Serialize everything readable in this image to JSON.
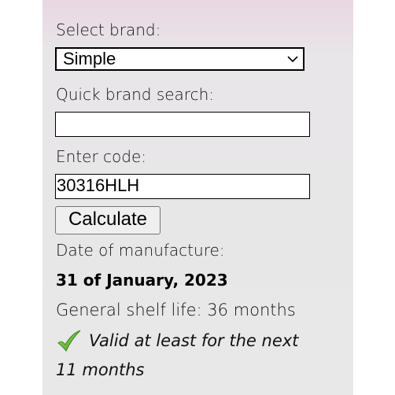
{
  "brand_selector": {
    "label": "Select brand:",
    "selected": "Simple"
  },
  "quick_search": {
    "label": "Quick brand search:",
    "value": ""
  },
  "code": {
    "label": "Enter code:",
    "value": "30316HLH"
  },
  "calculate_button": "Calculate",
  "result": {
    "date_label": "Date of manufacture:",
    "date_value": "31 of January, 2023",
    "shelf_life": "General shelf life: 36 months",
    "validity_line1": "Valid at least for the next",
    "validity_line2": "11 months"
  },
  "icons": {
    "status": "check-mark-icon",
    "dropdown": "chevron-down-icon"
  },
  "colors": {
    "check_green": "#5cb82a",
    "panel_top": "#e9d7e3",
    "panel_bg": "#e8e8e8"
  }
}
